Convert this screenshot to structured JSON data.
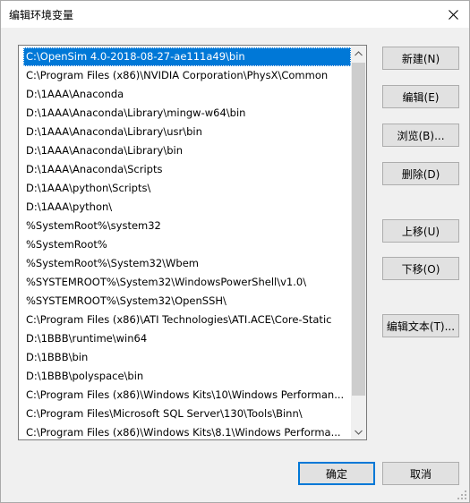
{
  "window": {
    "title": "编辑环境变量"
  },
  "path_list": {
    "selected_index": 0,
    "items": [
      "C:\\OpenSim 4.0-2018-08-27-ae111a49\\bin",
      "C:\\Program Files (x86)\\NVIDIA Corporation\\PhysX\\Common",
      "D:\\1AAA\\Anaconda",
      "D:\\1AAA\\Anaconda\\Library\\mingw-w64\\bin",
      "D:\\1AAA\\Anaconda\\Library\\usr\\bin",
      "D:\\1AAA\\Anaconda\\Library\\bin",
      "D:\\1AAA\\Anaconda\\Scripts",
      "D:\\1AAA\\python\\Scripts\\",
      "D:\\1AAA\\python\\",
      "%SystemRoot%\\system32",
      "%SystemRoot%",
      "%SystemRoot%\\System32\\Wbem",
      "%SYSTEMROOT%\\System32\\WindowsPowerShell\\v1.0\\",
      "%SYSTEMROOT%\\System32\\OpenSSH\\",
      "C:\\Program Files (x86)\\ATI Technologies\\ATI.ACE\\Core-Static",
      "D:\\1BBB\\runtime\\win64",
      "D:\\1BBB\\bin",
      "D:\\1BBB\\polyspace\\bin",
      "C:\\Program Files (x86)\\Windows Kits\\10\\Windows Performan...",
      "C:\\Program Files\\Microsoft SQL Server\\130\\Tools\\Binn\\",
      "C:\\Program Files (x86)\\Windows Kits\\8.1\\Windows Performa..."
    ]
  },
  "buttons": {
    "new_label": "新建(N)",
    "edit_label": "编辑(E)",
    "browse_label": "浏览(B)...",
    "delete_label": "删除(D)",
    "move_up_label": "上移(U)",
    "move_down_label": "下移(O)",
    "edit_text_label": "编辑文本(T)...",
    "ok_label": "确定",
    "cancel_label": "取消"
  },
  "icons": {
    "close": "close-icon",
    "scroll_up": "chevron-up-icon",
    "scroll_down": "chevron-down-icon",
    "resize": "resize-grip-icon"
  },
  "colors": {
    "selection": "#0078d7",
    "dialog_bg": "#f0f0f0",
    "default_button_border": "#0078d7"
  }
}
